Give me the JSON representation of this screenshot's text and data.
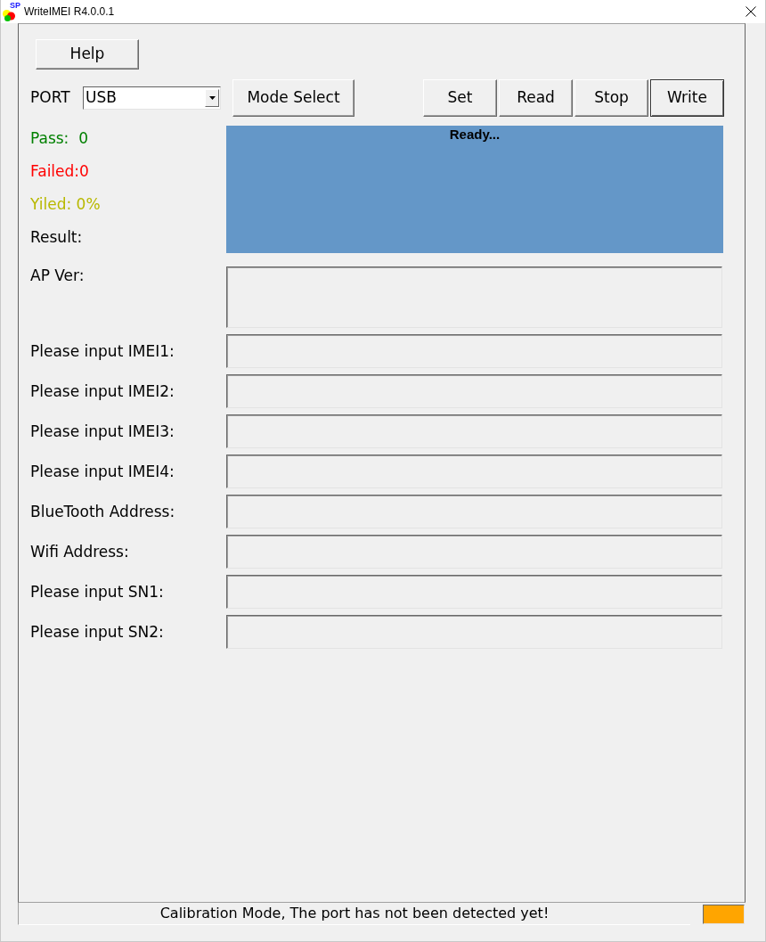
{
  "window": {
    "title": "WriteIMEI R4.0.0.1",
    "logo_text": "SP"
  },
  "help_button": "Help",
  "port": {
    "label": "PORT",
    "value": "USB"
  },
  "mode_button": "Mode Select",
  "action_buttons": [
    {
      "label": "Set",
      "default": false
    },
    {
      "label": "Read",
      "default": false
    },
    {
      "label": "Stop",
      "default": false
    },
    {
      "label": "Write",
      "default": true
    }
  ],
  "stats": [
    {
      "text": "Pass:  0",
      "color": "#008000"
    },
    {
      "text": "Failed:0",
      "color": "#ff0000"
    },
    {
      "text": "Yiled: 0%",
      "color": "#b8b800"
    },
    {
      "text": "Result:",
      "color": "#000000"
    }
  ],
  "result_panel": {
    "message": "Ready..."
  },
  "fields": [
    {
      "label": "AP Ver:",
      "kind": "multiline"
    },
    {
      "label": "Please input IMEI1:",
      "kind": "line"
    },
    {
      "label": "Please input IMEI2:",
      "kind": "line"
    },
    {
      "label": "Please input IMEI3:",
      "kind": "line"
    },
    {
      "label": "Please input IMEI4:",
      "kind": "line"
    },
    {
      "label": "BlueTooth Address:",
      "kind": "line"
    },
    {
      "label": "Wifi Address:",
      "kind": "line"
    },
    {
      "label": "Please input SN1:",
      "kind": "line"
    },
    {
      "label": "Please input SN2:",
      "kind": "line"
    }
  ],
  "status_bar": {
    "message": "Calibration Mode, The port has not been detected yet!"
  }
}
